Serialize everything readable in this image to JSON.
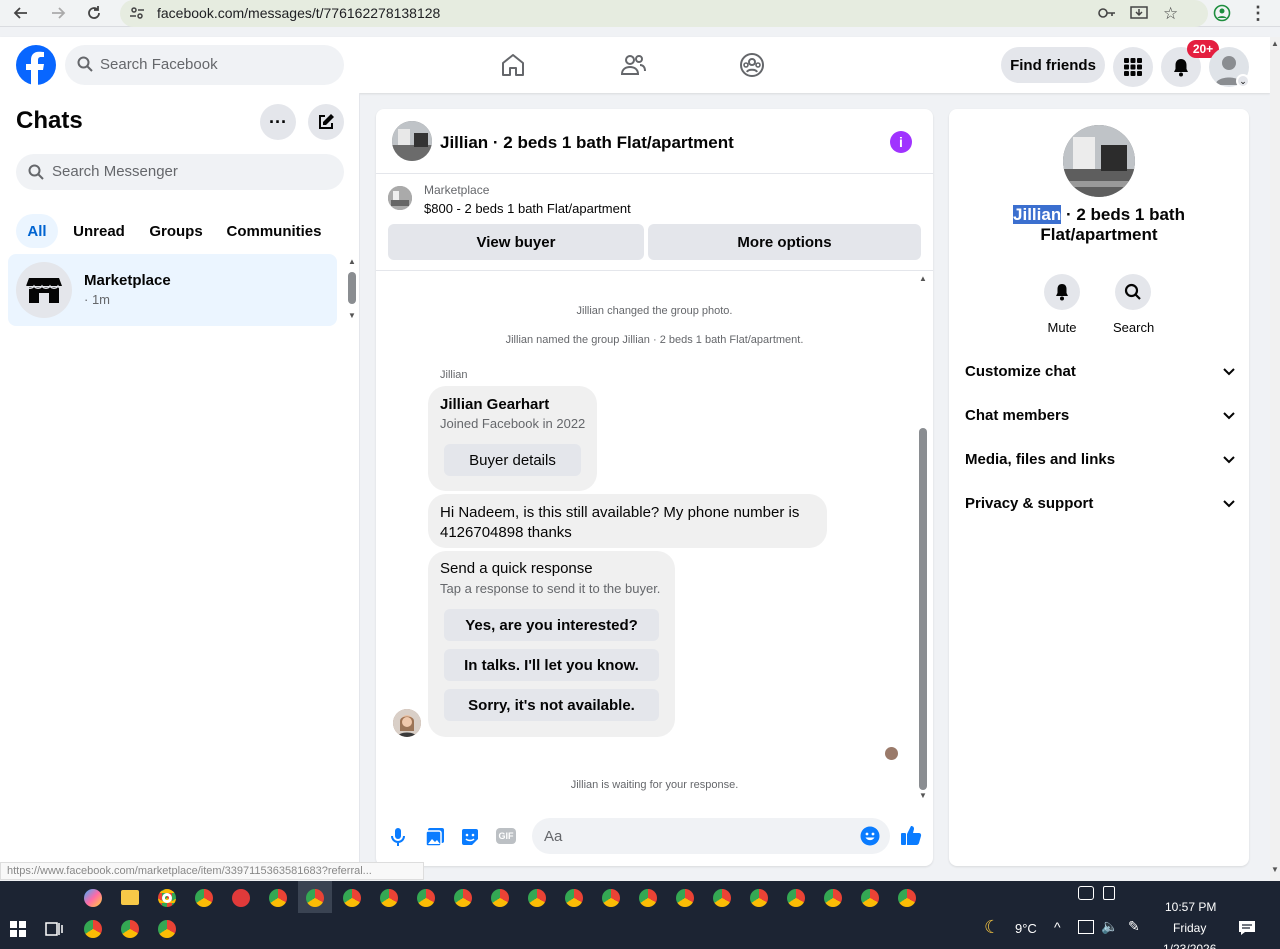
{
  "browser": {
    "url": "facebook.com/messages/t/776162278138128"
  },
  "fb_header": {
    "search_placeholder": "Search Facebook",
    "find_friends": "Find friends",
    "notification_badge": "20+"
  },
  "left": {
    "title": "Chats",
    "search_placeholder": "Search Messenger",
    "tabs": [
      "All",
      "Unread",
      "Groups",
      "Communities"
    ],
    "chat_item": {
      "name": "Marketplace",
      "time": "· 1m"
    }
  },
  "conversation": {
    "title": "Jillian · 2 beds 1 bath Flat/apartment",
    "marketplace_label": "Marketplace",
    "listing": "$800 - 2 beds 1 bath Flat/apartment",
    "view_buyer": "View buyer",
    "more_options": "More options",
    "system_messages": [
      "Jillian changed the group photo.",
      "Jillian named the group Jillian · 2 beds 1 bath Flat/apartment."
    ],
    "sender_label": "Jillian",
    "buyer_card": {
      "name": "Jillian Gearhart",
      "joined": "Joined Facebook in 2022",
      "button": "Buyer details"
    },
    "message": "Hi Nadeem, is this still available? My phone number is 4126704898 thanks",
    "quick_response": {
      "title": "Send a quick response",
      "subtitle": "Tap a response to send it to the buyer.",
      "options": [
        "Yes, are you interested?",
        "In talks. I'll let you know.",
        "Sorry, it's not available."
      ]
    },
    "waiting": "Jillian is waiting for your response.",
    "composer_placeholder": "Aa"
  },
  "right": {
    "title_highlight": "Jillian",
    "title_rest": " · 2 beds 1 bath Flat/apartment",
    "actions": [
      "Mute",
      "Search"
    ],
    "rows": [
      "Customize chat",
      "Chat members",
      "Media, files and links",
      "Privacy & support"
    ]
  },
  "status_url": "https://www.facebook.com/marketplace/item/3397115363581683?referral...",
  "taskbar": {
    "weather": "9°C",
    "time": "10:57 PM",
    "day": "Friday",
    "date": "1/23/2026"
  },
  "colors": {
    "fb_blue": "#0866ff",
    "messenger_blue": "#0a7cff",
    "badge_red": "#e41e3f",
    "info_purple": "#a033ff"
  }
}
